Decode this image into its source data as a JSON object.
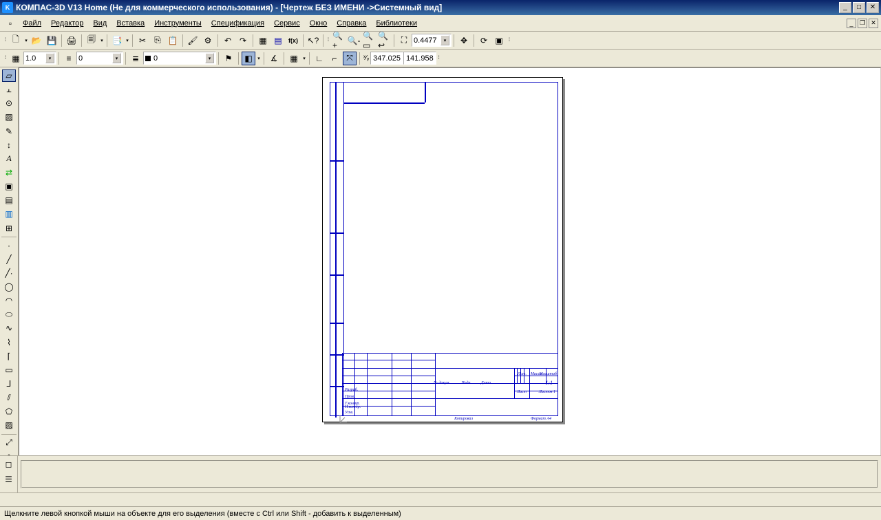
{
  "title": "КОМПАС-3D V13 Home (Не для коммерческого использования) - [Чертеж БЕЗ ИМЕНИ ->Системный вид]",
  "menu": [
    "Файл",
    "Редактор",
    "Вид",
    "Вставка",
    "Инструменты",
    "Спецификация",
    "Сервис",
    "Окно",
    "Справка",
    "Библиотеки"
  ],
  "tb1": {
    "zoom": "0.4477"
  },
  "tb2": {
    "step": "1.0",
    "style": "0",
    "layer": "0",
    "coordX": "347.025",
    "coordY": "141.958"
  },
  "titleblock": {
    "scale": "1:1",
    "doc": "№ докум.",
    "pod": "Подп.",
    "data": "Дата",
    "razrab": "Разраб.",
    "prov": "Пров.",
    "tkoktr": "Т.контр.",
    "nkontr": "Н.контр.",
    "utv": "Утв.",
    "list": "Лист",
    "listov": "Листов 1",
    "lit": "Лит.",
    "mass": "Масса",
    "mash": "Масштаб",
    "kopir": "Копировал",
    "format": "Формат   A4"
  },
  "status": "Щелкните левой кнопкой мыши на объекте для его выделения (вместе с Ctrl или Shift - добавить к выделенным)"
}
